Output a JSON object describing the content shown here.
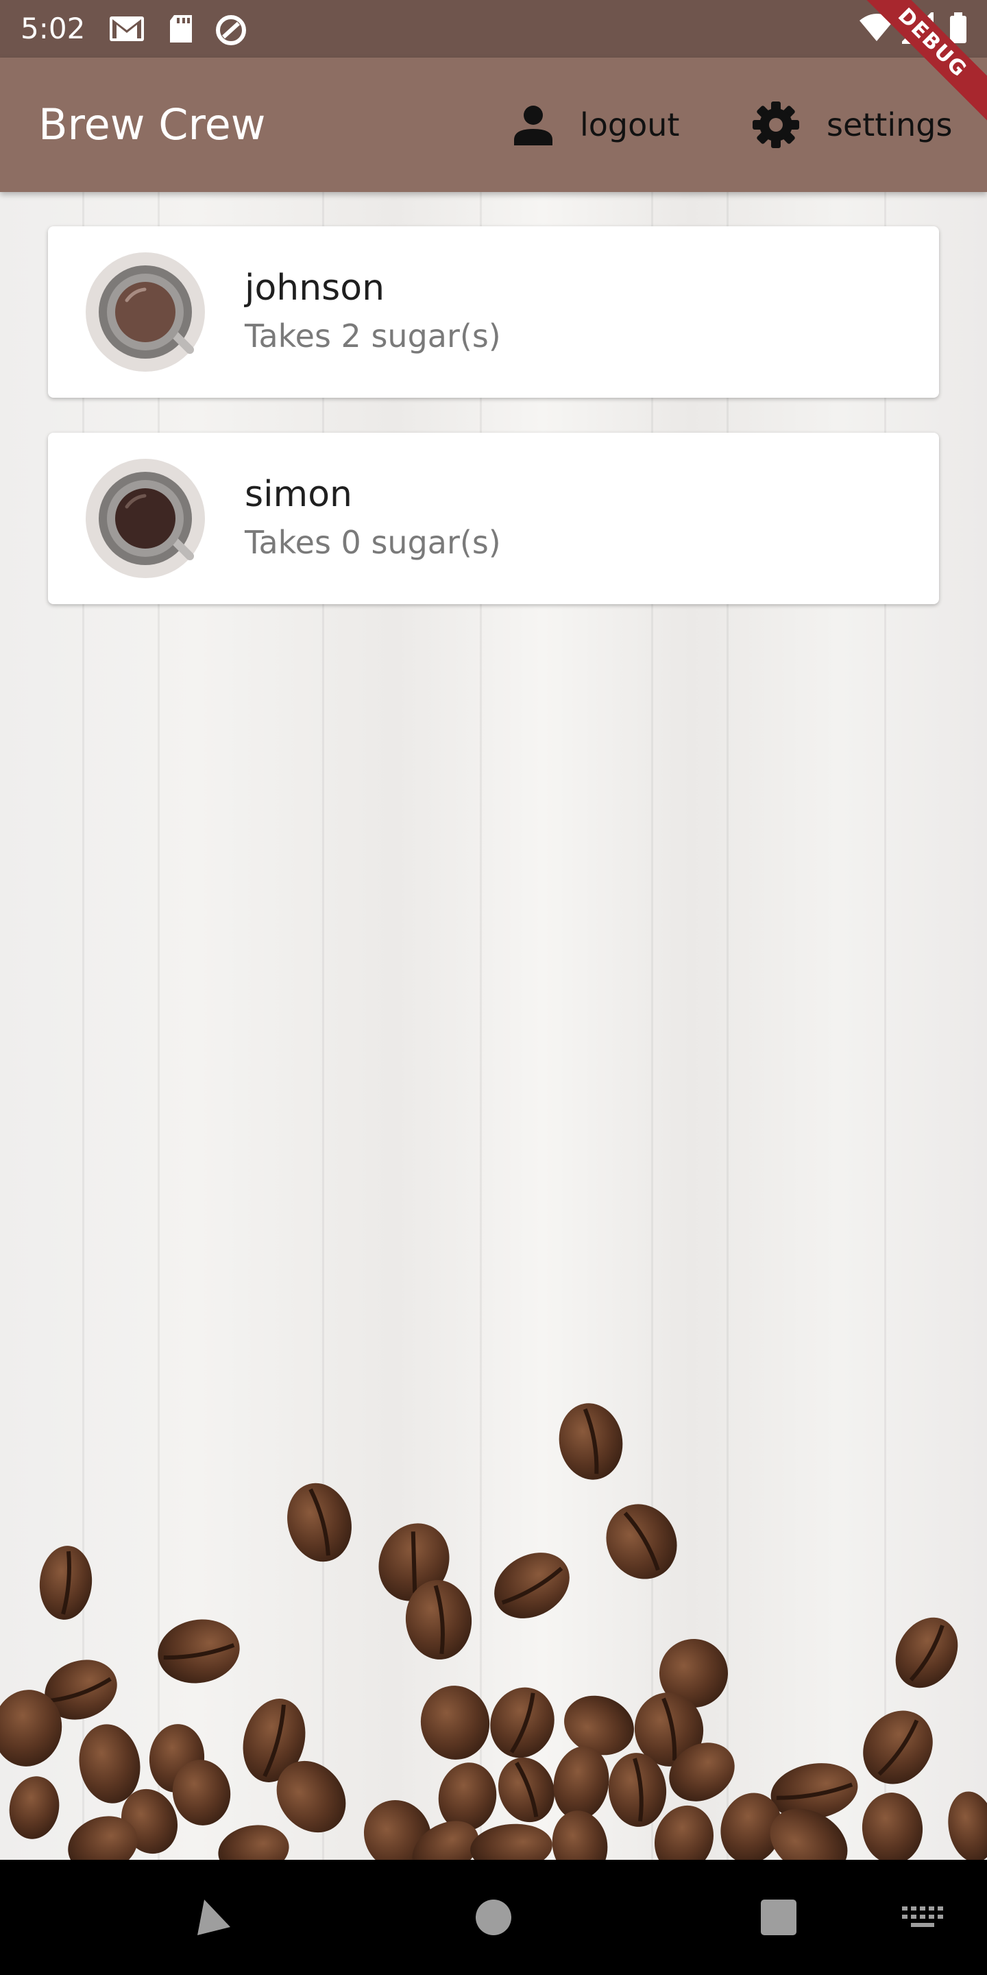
{
  "status_bar": {
    "time": "5:02",
    "left_icons": [
      "gmail-icon",
      "sd-card-icon",
      "at-sign-icon"
    ],
    "right_icons": [
      "wifi-icon",
      "signal-icon",
      "battery-icon"
    ]
  },
  "debug_banner": {
    "label": "DEBUG"
  },
  "app_bar": {
    "title": "Brew Crew",
    "background_color": "#8d6e63",
    "actions": [
      {
        "label": "logout",
        "icon": "person-icon"
      },
      {
        "label": "settings",
        "icon": "gear-icon"
      }
    ]
  },
  "brews": [
    {
      "name": "johnson",
      "subtitle": "Takes 2 sugar(s)",
      "icon": "coffee-cup-icon",
      "coffee_color": "#6d4c41"
    },
    {
      "name": "simon",
      "subtitle": "Takes 0 sugar(s)",
      "icon": "coffee-cup-icon",
      "coffee_color": "#3e2723"
    }
  ],
  "nav_bar": {
    "buttons": [
      "back-icon",
      "home-icon",
      "recents-icon",
      "keyboard-icon"
    ]
  }
}
